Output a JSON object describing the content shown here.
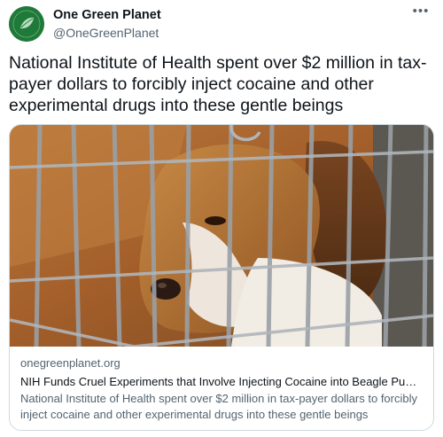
{
  "account": {
    "display_name": "One Green Planet",
    "handle": "@OneGreenPlanet",
    "avatar_text": "ONE GREEN PLANET"
  },
  "menu": {
    "more_label": "•••"
  },
  "tweet": {
    "text": "National Institute of Health spent over $2 million in tax-payer dollars to forcibly inject cocaine and other experimental drugs into these gentle beings"
  },
  "card": {
    "image_alt": "beagle-in-cage-photo",
    "domain": "onegreenplanet.org",
    "title": "NIH Funds Cruel Experiments that Involve Injecting Cocaine into Beagle Puppies…",
    "description": "National Institute of Health spent over $2 million in tax-payer dollars to forcibly inject cocaine and other experimental drugs into these gentle beings"
  },
  "colors": {
    "avatar_green": "#1f7a3a",
    "text_primary": "#0f1419",
    "text_secondary": "#536471",
    "border": "#cfd9de"
  }
}
